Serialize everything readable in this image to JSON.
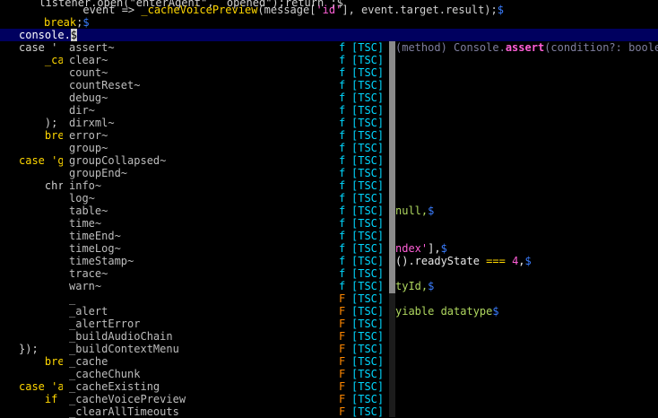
{
  "editor": {
    "line0": "      listener.open(\"enterAgent\",  opened\");return ;$",
    "line1_a": "      event => ",
    "line1_fn": "_cacheVoicePreview",
    "line1_b": "(message[",
    "line1_str": "'id'",
    "line1_c": "], event.target.result);",
    "line2_kw": "break",
    "line2_rest": ";",
    "line3_text": "console.",
    "eol": "$",
    "background": [
      {
        "row": 4,
        "text": "case '",
        "hi": "",
        "cls": ""
      },
      {
        "row": 5,
        "text": "    _ca",
        "cls": "fn"
      },
      {
        "row": 10,
        "text": "    );",
        "cls": ""
      },
      {
        "row": 11,
        "text": "    bre",
        "cls": "kw"
      },
      {
        "row": 13,
        "text": "case 'g",
        "cls": "kw"
      },
      {
        "row": 15,
        "text": "    chr",
        "cls": ""
      },
      {
        "row": 28,
        "text": "});",
        "cls": ""
      },
      {
        "row": 29,
        "text": "    bre",
        "cls": "kw"
      },
      {
        "row": 31,
        "text": "case 'a",
        "cls": "kw"
      },
      {
        "row": 32,
        "text": "    if",
        "cls": "kw"
      }
    ],
    "right_fragments": [
      {
        "row": 17,
        "a": "null,",
        "cls": "green"
      },
      {
        "row": 20,
        "a": "ndex'",
        "b": "],",
        "cls": "str"
      },
      {
        "row": 21,
        "a": "().readyState ",
        "op": "===",
        "num": " 4",
        "b": ",",
        "cls": "white"
      },
      {
        "row": 23,
        "a": "tyId,",
        "cls": "green"
      },
      {
        "row": 25,
        "a": "yiable datatype",
        "cls": "green"
      }
    ]
  },
  "completion": {
    "signature_prefix": "(method) Console.",
    "signature_name": "assert",
    "signature_suffix": "(condition?: boole",
    "items": [
      {
        "label": "assert~",
        "kind": "f",
        "source": "[TSC]"
      },
      {
        "label": "clear~",
        "kind": "f",
        "source": "[TSC]"
      },
      {
        "label": "count~",
        "kind": "f",
        "source": "[TSC]"
      },
      {
        "label": "countReset~",
        "kind": "f",
        "source": "[TSC]"
      },
      {
        "label": "debug~",
        "kind": "f",
        "source": "[TSC]"
      },
      {
        "label": "dir~",
        "kind": "f",
        "source": "[TSC]"
      },
      {
        "label": "dirxml~",
        "kind": "f",
        "source": "[TSC]"
      },
      {
        "label": "error~",
        "kind": "f",
        "source": "[TSC]"
      },
      {
        "label": "group~",
        "kind": "f",
        "source": "[TSC]"
      },
      {
        "label": "groupCollapsed~",
        "kind": "f",
        "source": "[TSC]"
      },
      {
        "label": "groupEnd~",
        "kind": "f",
        "source": "[TSC]"
      },
      {
        "label": "info~",
        "kind": "f",
        "source": "[TSC]"
      },
      {
        "label": "log~",
        "kind": "f",
        "source": "[TSC]"
      },
      {
        "label": "table~",
        "kind": "f",
        "source": "[TSC]"
      },
      {
        "label": "time~",
        "kind": "f",
        "source": "[TSC]"
      },
      {
        "label": "timeEnd~",
        "kind": "f",
        "source": "[TSC]"
      },
      {
        "label": "timeLog~",
        "kind": "f",
        "source": "[TSC]"
      },
      {
        "label": "timeStamp~",
        "kind": "f",
        "source": "[TSC]"
      },
      {
        "label": "trace~",
        "kind": "f",
        "source": "[TSC]"
      },
      {
        "label": "warn~",
        "kind": "f",
        "source": "[TSC]"
      },
      {
        "label": "_",
        "kind": "F",
        "source": "[TSC]"
      },
      {
        "label": "_alert",
        "kind": "F",
        "source": "[TSC]"
      },
      {
        "label": "_alertError",
        "kind": "F",
        "source": "[TSC]"
      },
      {
        "label": "_buildAudioChain",
        "kind": "F",
        "source": "[TSC]"
      },
      {
        "label": "_buildContextMenu",
        "kind": "F",
        "source": "[TSC]"
      },
      {
        "label": "_cache",
        "kind": "F",
        "source": "[TSC]"
      },
      {
        "label": "_cacheChunk",
        "kind": "F",
        "source": "[TSC]"
      },
      {
        "label": "_cacheExisting",
        "kind": "F",
        "source": "[TSC]"
      },
      {
        "label": "_cacheVoicePreview",
        "kind": "F",
        "source": "[TSC]"
      },
      {
        "label": "_clearAllTimeouts",
        "kind": "F",
        "source": "[TSC]"
      }
    ]
  }
}
